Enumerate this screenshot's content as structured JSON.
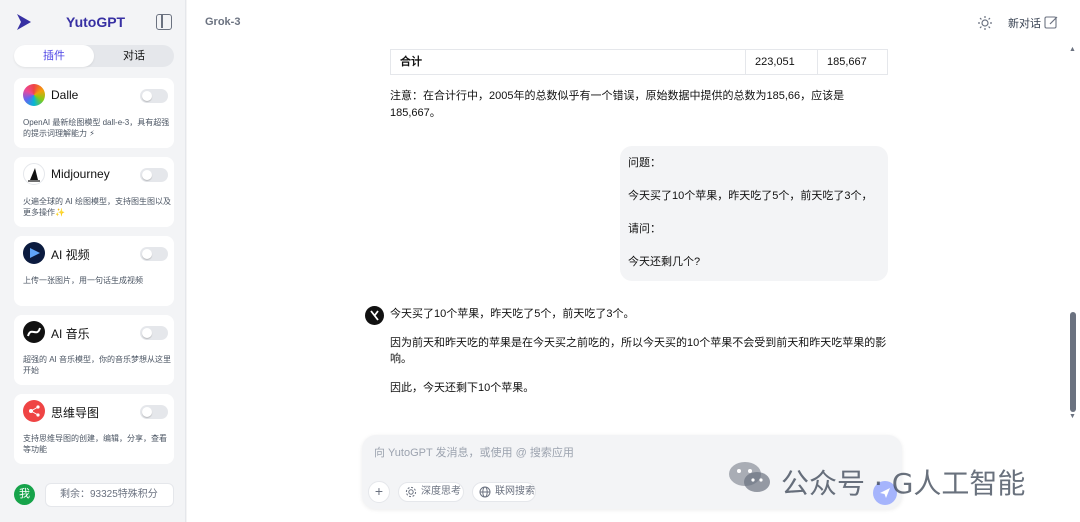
{
  "app": {
    "name": "YutoGPT"
  },
  "tabs": {
    "plugins": "插件",
    "chat": "对话"
  },
  "plugins": [
    {
      "name": "Dalle",
      "desc": "OpenAI 最新绘图模型 dall-e-3，具有超强的提示词理解能力 ⚡",
      "icon": "dalle-gradient-icon",
      "enabled": false
    },
    {
      "name": "Midjourney",
      "desc": "火遍全球的 AI 绘图模型，支持图生图以及更多操作✨",
      "icon": "midjourney-sail-icon",
      "enabled": false
    },
    {
      "name": "AI 视频",
      "desc": "上传一张图片，用一句话生成视频",
      "icon": "video-icon",
      "enabled": false
    },
    {
      "name": "AI 音乐",
      "desc": "超强的 AI 音乐模型，你的音乐梦想从这里开始",
      "icon": "music-icon",
      "enabled": false
    },
    {
      "name": "思维导图",
      "desc": "支持思维导图的创建，编辑，分享，查看等功能",
      "icon": "mindmap-icon",
      "enabled": false
    }
  ],
  "user": {
    "avatar_text": "我",
    "quota": "剩余：93325特殊积分"
  },
  "header": {
    "model": "Grok-3",
    "new_chat": "新对话"
  },
  "table": {
    "label": "合计",
    "col1": "223,051",
    "col2": "185,667"
  },
  "note": "注意：在合计行中，2005年的总数似乎有一个错误，原始数据中提供的总数为185,66，应该是185,667。",
  "user_message": [
    "问题：",
    "今天买了10个苹果，昨天吃了5个，前天吃了3个，",
    "请问：",
    "今天还剩几个?"
  ],
  "bot_message": [
    "今天买了10个苹果，昨天吃了5个，前天吃了3个。",
    "因为前天和昨天吃的苹果是在今天买之前吃的，所以今天买的10个苹果不会受到前天和昨天吃苹果的影响。",
    "因此，今天还剩下10个苹果。"
  ],
  "composer": {
    "placeholder": "向 YutoGPT 发消息，或使用 @ 搜索应用",
    "deep_think": "深度思考",
    "web_search": "联网搜索"
  },
  "watermark": "公众号 · G人工智能",
  "colors": {
    "brand": "#3730a3",
    "accent": "#4f46e5",
    "send": "#a5b4fc"
  }
}
